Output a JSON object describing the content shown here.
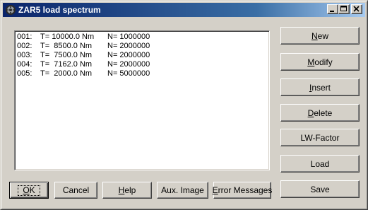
{
  "window": {
    "title": "ZAR5 load spectrum",
    "app_icon": "gear-icon",
    "controls": {
      "minimize": "minimize-icon",
      "maximize": "maximize-icon",
      "close": "close-icon"
    }
  },
  "list": {
    "items": [
      {
        "index": "001:",
        "torque": "T= 10000.0 Nm",
        "cycles": "N= 1000000"
      },
      {
        "index": "002:",
        "torque": "T=  8500.0 Nm",
        "cycles": "N= 2000000"
      },
      {
        "index": "003:",
        "torque": "T=  7500.0 Nm",
        "cycles": "N= 2000000"
      },
      {
        "index": "004:",
        "torque": "T=  7162.0 Nm",
        "cycles": "N= 2000000"
      },
      {
        "index": "005:",
        "torque": "T=  2000.0 Nm",
        "cycles": "N= 5000000"
      }
    ]
  },
  "side_buttons": {
    "new": {
      "mnemonic": "N",
      "rest": "ew"
    },
    "modify": {
      "mnemonic": "M",
      "rest": "odify"
    },
    "insert": {
      "mnemonic": "I",
      "rest": "nsert"
    },
    "delete": {
      "mnemonic": "D",
      "rest": "elete"
    },
    "lw_factor": "LW-Factor",
    "load": "Load",
    "save": "Save"
  },
  "bottom_buttons": {
    "ok": {
      "mnemonic": "O",
      "rest": "K"
    },
    "cancel": "Cancel",
    "help": {
      "mnemonic": "H",
      "rest": "elp"
    },
    "aux_image": "Aux. Image",
    "error_messages": {
      "mnemonic": "E",
      "rest": "rror Messages"
    }
  }
}
